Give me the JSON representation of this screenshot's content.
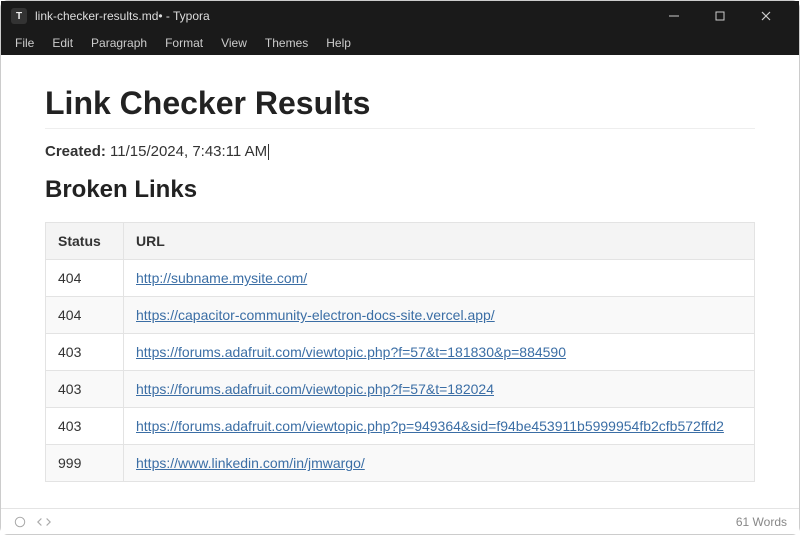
{
  "window": {
    "title": "link-checker-results.md• - Typora",
    "app_glyph": "T"
  },
  "menu": [
    "File",
    "Edit",
    "Paragraph",
    "Format",
    "View",
    "Themes",
    "Help"
  ],
  "document": {
    "h1": "Link Checker Results",
    "created_label": "Created:",
    "created_value": "11/15/2024, 7:43:11 AM",
    "h2": "Broken Links",
    "table": {
      "headers": [
        "Status",
        "URL"
      ],
      "rows": [
        {
          "status": "404",
          "url": "http://subname.mysite.com/"
        },
        {
          "status": "404",
          "url": "https://capacitor-community-electron-docs-site.vercel.app/"
        },
        {
          "status": "403",
          "url": "https://forums.adafruit.com/viewtopic.php?f=57&t=181830&p=884590"
        },
        {
          "status": "403",
          "url": "https://forums.adafruit.com/viewtopic.php?f=57&t=182024"
        },
        {
          "status": "403",
          "url": "https://forums.adafruit.com/viewtopic.php?p=949364&sid=f94be453911b5999954fb2cfb572ffd2"
        },
        {
          "status": "999",
          "url": "https://www.linkedin.com/in/jmwargo/"
        }
      ]
    }
  },
  "statusbar": {
    "word_count": "61 Words"
  }
}
